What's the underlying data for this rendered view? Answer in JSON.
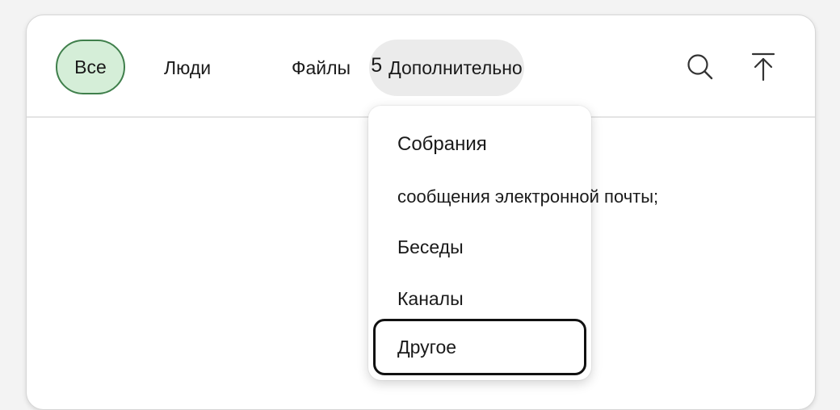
{
  "tabs": {
    "all": "Все",
    "people": "Люди",
    "files": "Файлы",
    "more_count": "5",
    "more_label": "Дополнительно"
  },
  "icons": {
    "search": "search-icon",
    "scroll_top": "arrow-up-to-top-icon"
  },
  "dropdown": {
    "items": [
      "Собрания",
      "сообщения электронной почты;",
      "Беседы",
      "Каналы",
      "Другое"
    ]
  },
  "colors": {
    "selected_pill_bg": "#d5eed8",
    "selected_pill_border": "#3f7f4b",
    "more_tab_bg": "#ebebeb",
    "focus_outline": "#111111"
  }
}
